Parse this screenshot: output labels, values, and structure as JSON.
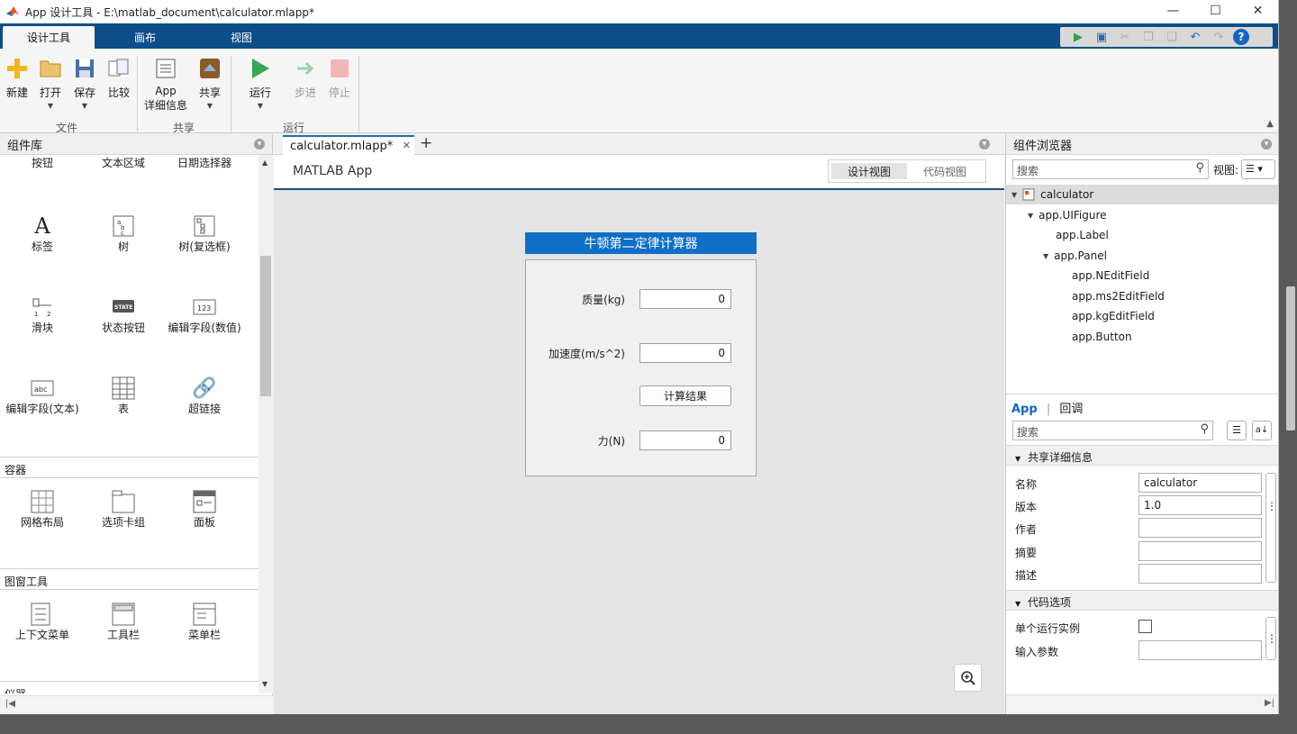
{
  "window": {
    "title": "App 设计工具 - E:\\matlab_document\\calculator.mlapp*",
    "controls": [
      "—",
      "☐",
      "✕"
    ]
  },
  "ribbon_tabs": [
    "设计工具",
    "画布",
    "视图"
  ],
  "ribbon": {
    "new": "新建",
    "open": "打开",
    "save": "保存",
    "compare": "比较",
    "group_file": "文件",
    "app_details_line1": "App",
    "app_details_line2": "详细信息",
    "share": "共享",
    "group_share": "共享",
    "run": "运行",
    "step": "步进",
    "stop": "停止",
    "group_run": "运行"
  },
  "library": {
    "title": "组件库",
    "top_labels": [
      "按钮",
      "文本区域",
      "日期选择器"
    ],
    "row1": [
      "标签",
      "树",
      "树(复选框)"
    ],
    "row2": [
      "滑块",
      "状态按钮",
      "编辑字段(数值)"
    ],
    "row3": [
      "编辑字段(文本)",
      "表",
      "超链接"
    ],
    "containers_header": "容器",
    "containers": [
      "网格布局",
      "选项卡组",
      "面板"
    ],
    "figure_tools_header": "图窗工具",
    "figure_tools": [
      "上下文菜单",
      "工具栏",
      "菜单栏"
    ],
    "cut_label": "仪器"
  },
  "doc": {
    "tab_name": "calculator.mlapp*",
    "app_label": "MATLAB App",
    "view_design": "设计视图",
    "view_code": "代码视图"
  },
  "app": {
    "title": "牛顿第二定律计算器",
    "mass_label": "质量(kg)",
    "mass_value": "0",
    "accel_label": "加速度(m/s^2)",
    "accel_value": "0",
    "button_label": "计算结果",
    "force_label": "力(N)",
    "force_value": "0"
  },
  "browser": {
    "title": "组件浏览器",
    "search_placeholder": "搜索",
    "view_label": "视图:",
    "tree": [
      "calculator",
      "app.UIFigure",
      "app.Label",
      "app.Panel",
      "app.NEditField",
      "app.ms2EditField",
      "app.kgEditField",
      "app.Button"
    ]
  },
  "inspector": {
    "tab_app": "App",
    "tab_callbacks": "回调",
    "search_placeholder": "搜索",
    "section_share": "共享详细信息",
    "name_label": "名称",
    "name_value": "calculator",
    "version_label": "版本",
    "version_value": "1.0",
    "author_label": "作者",
    "summary_label": "摘要",
    "desc_label": "描述",
    "section_code": "代码选项",
    "single_instance_label": "单个运行实例",
    "input_args_label": "输入参数"
  }
}
